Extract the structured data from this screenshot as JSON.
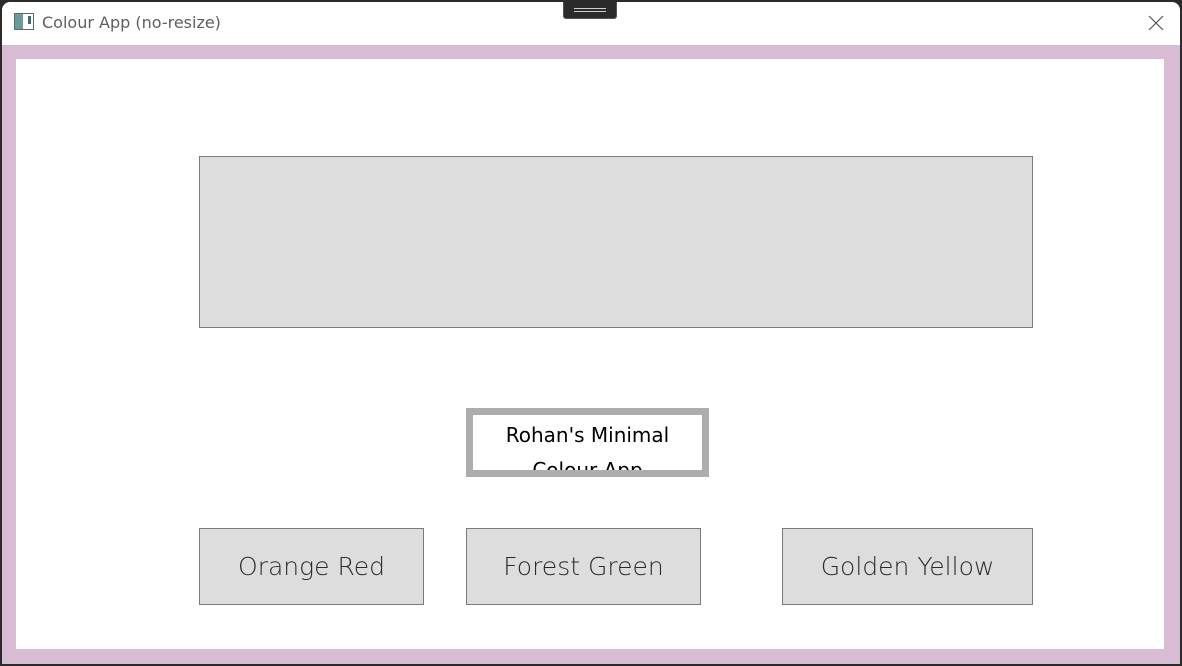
{
  "window": {
    "title": "Colour App (no-resize)",
    "frame_color": "#d7bcd4",
    "client_background": "#ffffff"
  },
  "display_panel": {
    "color": "#dddddd"
  },
  "label": {
    "line1": "Rohan's Minimal",
    "line2": "Colour App"
  },
  "buttons": [
    {
      "label": "Orange Red"
    },
    {
      "label": "Forest Green"
    },
    {
      "label": "Golden Yellow"
    }
  ]
}
